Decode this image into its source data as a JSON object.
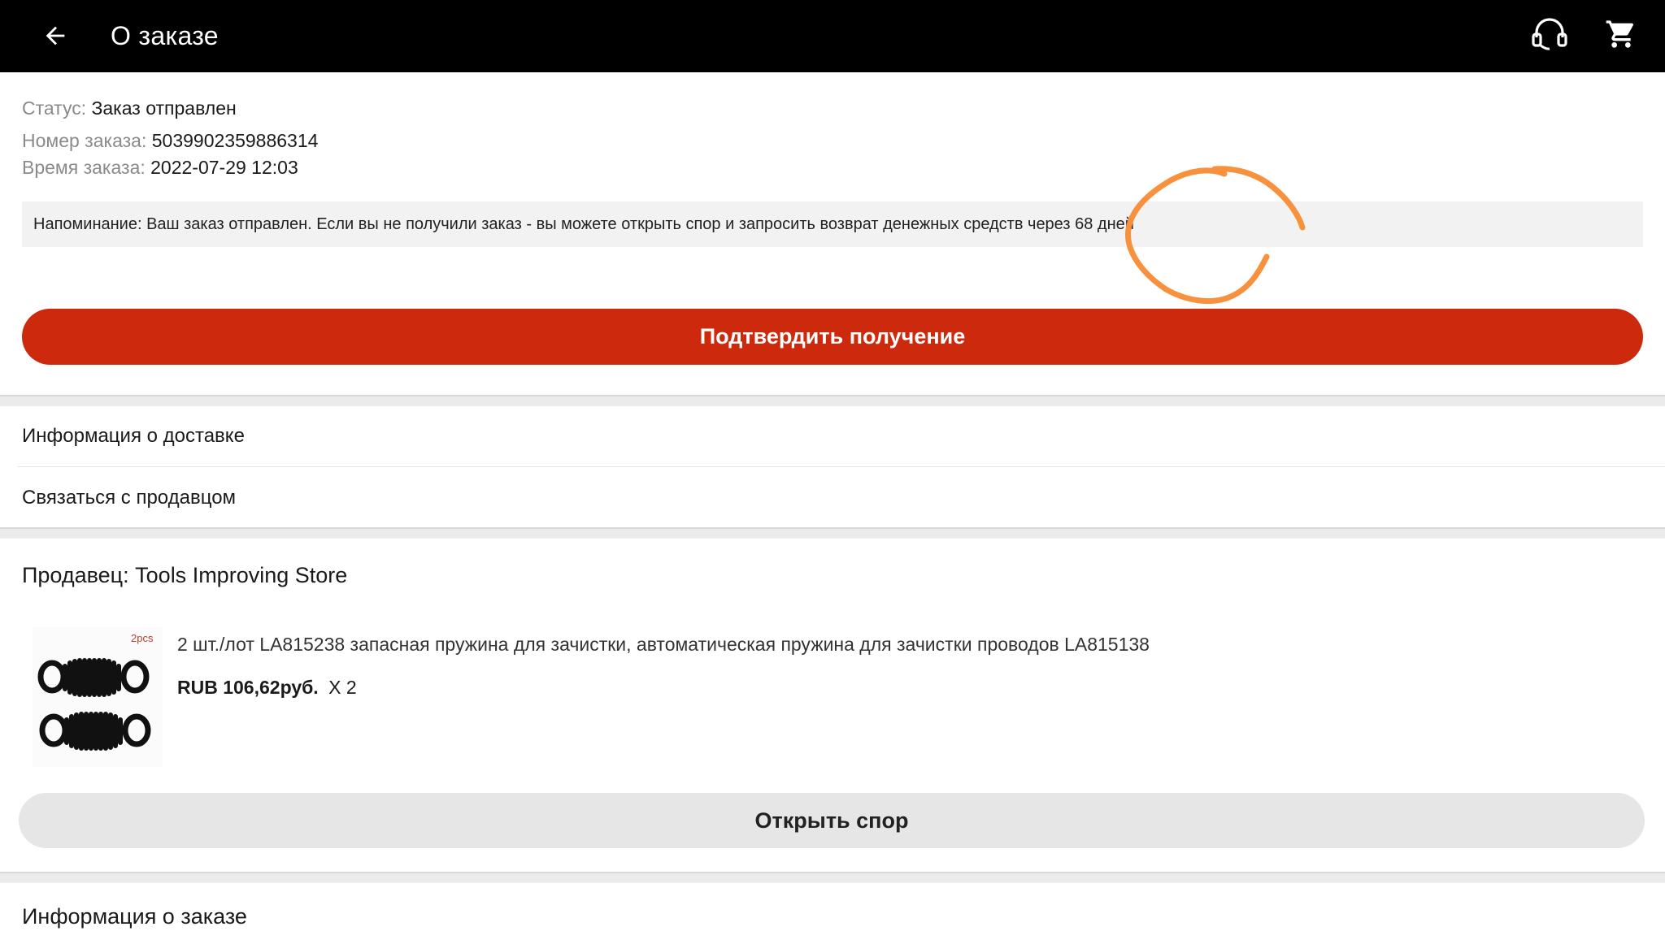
{
  "header": {
    "title": "О заказе",
    "back_icon": "arrow-left-icon",
    "support_icon": "headset-icon",
    "cart_icon": "shopping-cart-icon"
  },
  "order": {
    "status_label": "Статус:",
    "status_value": "Заказ отправлен",
    "number_label": "Номер заказа:",
    "number_value": "5039902359886314",
    "time_label": "Время заказа:",
    "time_value": "2022-07-29 12:03"
  },
  "reminder": {
    "text": "Напоминание: Ваш заказ отправлен. Если вы не получили заказ - вы можете открыть спор и запросить возврат денежных средств через 68 дней"
  },
  "actions": {
    "confirm_label": "Подтвердить получение",
    "dispute_label": "Открыть спор"
  },
  "menu": {
    "delivery_info": "Информация о доставке",
    "contact_seller": "Связаться с продавцом"
  },
  "seller": {
    "label": "Продавец:",
    "name": "Tools Improving Store"
  },
  "product": {
    "image_badge": "2pcs",
    "title": "2 шт./лот LA815238 запасная пружина для зачистки, автоматическая пружина для зачистки проводов LA815138",
    "price": "RUB 106,62руб.",
    "quantity": "X 2"
  },
  "sections": {
    "order_info": "Информация о заказе"
  },
  "colors": {
    "header_bg": "#000000",
    "confirm_bg": "#cc290d",
    "dispute_bg": "#e6e6e6",
    "annotation": "#f7913d"
  }
}
